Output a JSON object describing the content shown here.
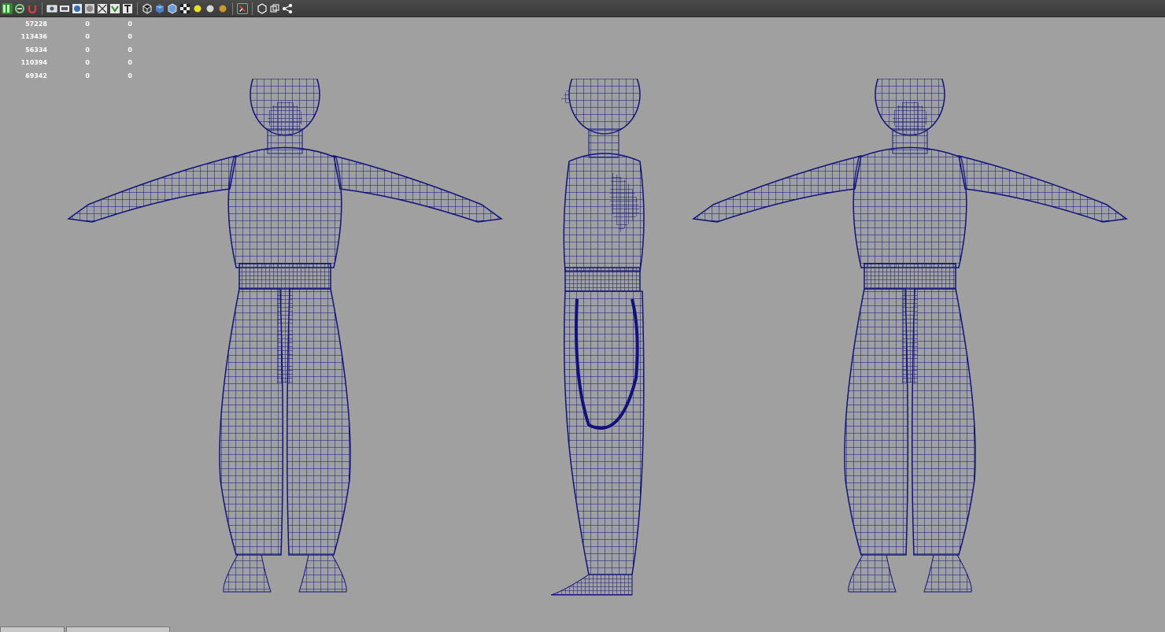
{
  "toolbar": {
    "icons": [
      "layout-icon",
      "snap-icon",
      "magnet-icon",
      "select-camera-icon",
      "film-gate-icon",
      "sphere-icon",
      "grid-icon",
      "wire-toggle-icon",
      "gate-mask-icon",
      "text-icon",
      "wireframe-cube-icon",
      "smooth-shade-icon",
      "texture-cube-icon",
      "checker-icon",
      "light-yellow-icon",
      "light-grey-icon",
      "light-gold-icon",
      "xray-icon",
      "isolate-icon",
      "multi-view-icon",
      "share-icon"
    ]
  },
  "hud": {
    "rows": [
      {
        "a": "57228",
        "b": "0",
        "c": "0"
      },
      {
        "a": "113436",
        "b": "0",
        "c": "0"
      },
      {
        "a": "56334",
        "b": "0",
        "c": "0"
      },
      {
        "a": "110394",
        "b": "0",
        "c": "0"
      },
      {
        "a": "69342",
        "b": "0",
        "c": "0"
      }
    ]
  },
  "colors": {
    "viewport_bg": "#a0a0a0",
    "wireframe": "#10107a",
    "toolbar_bg": "#444444"
  }
}
